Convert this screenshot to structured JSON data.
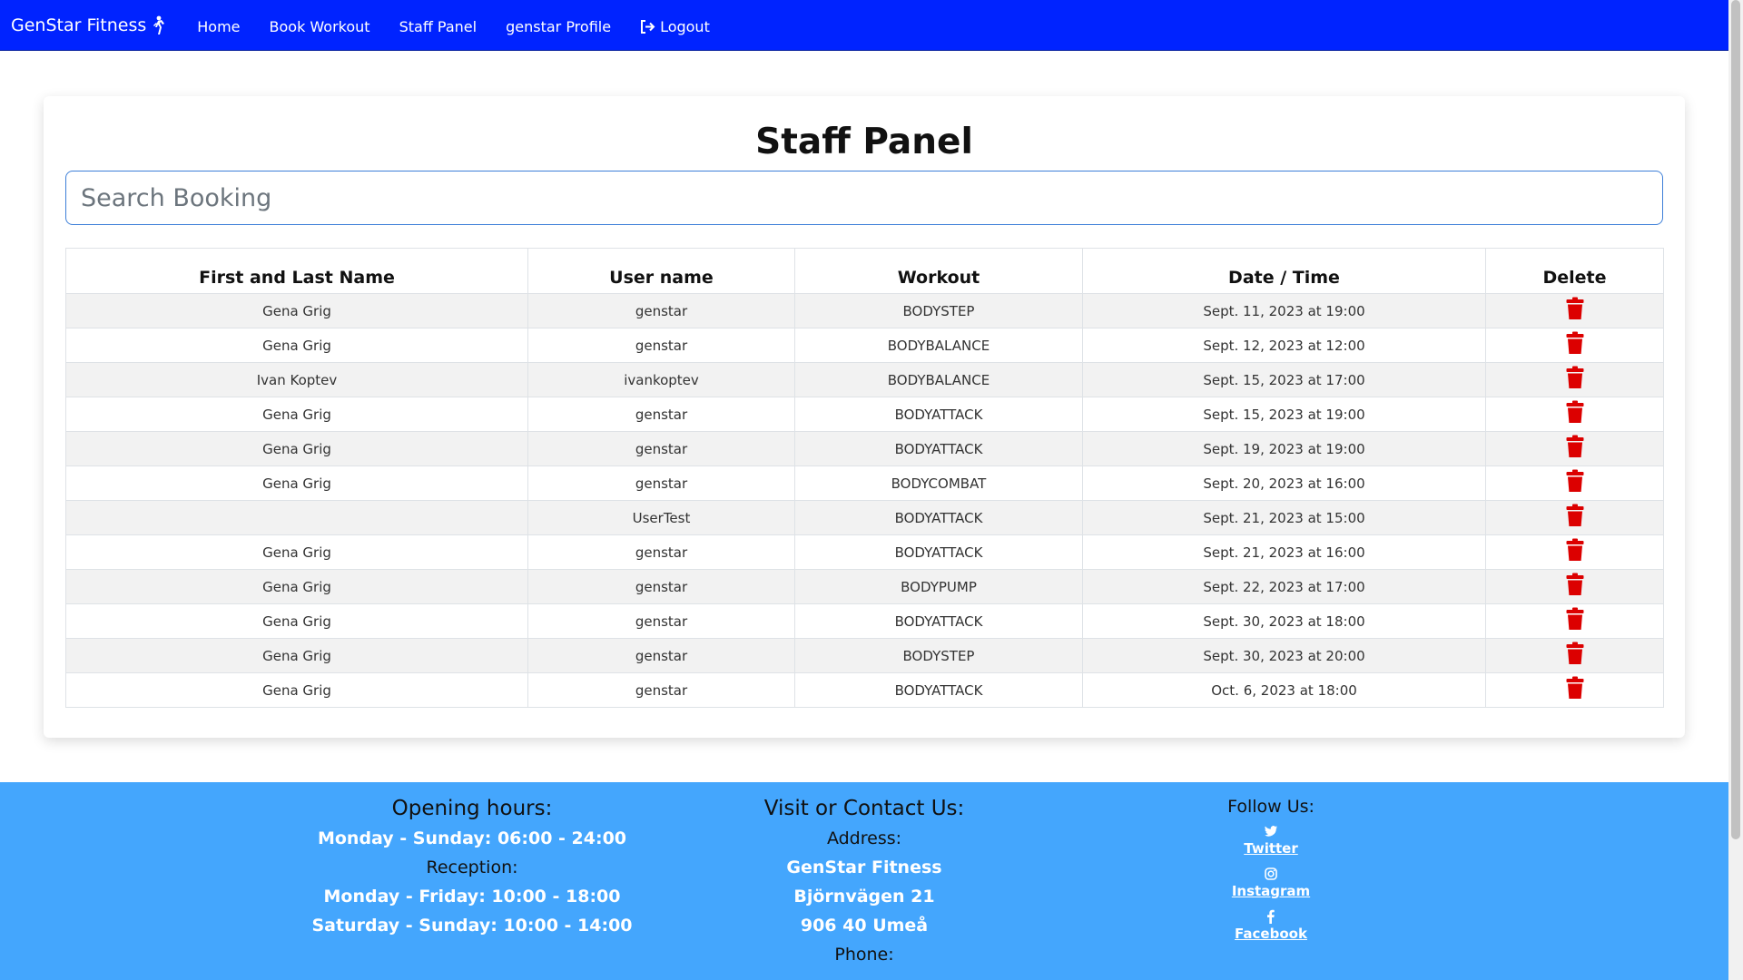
{
  "navbar": {
    "brand": "GenStar Fitness",
    "links": [
      {
        "label": "Home"
      },
      {
        "label": "Book Workout"
      },
      {
        "label": "Staff Panel"
      },
      {
        "label": "genstar Profile"
      },
      {
        "label": "Logout"
      }
    ],
    "color": "#0023ff"
  },
  "panel": {
    "title": "Staff Panel",
    "search_placeholder": "Search Booking"
  },
  "table": {
    "headers": [
      "First and Last Name",
      "User name",
      "Workout",
      "Date / Time",
      "Delete"
    ],
    "rows": [
      [
        "Gena Grig",
        "genstar",
        "BODYSTEP",
        "Sept. 11, 2023 at 19:00"
      ],
      [
        "Gena Grig",
        "genstar",
        "BODYBALANCE",
        "Sept. 12, 2023 at 12:00"
      ],
      [
        "Ivan Koptev",
        "ivankoptev",
        "BODYBALANCE",
        "Sept. 15, 2023 at 17:00"
      ],
      [
        "Gena Grig",
        "genstar",
        "BODYATTACK",
        "Sept. 15, 2023 at 19:00"
      ],
      [
        "Gena Grig",
        "genstar",
        "BODYATTACK",
        "Sept. 19, 2023 at 19:00"
      ],
      [
        "Gena Grig",
        "genstar",
        "BODYCOMBAT",
        "Sept. 20, 2023 at 16:00"
      ],
      [
        "",
        "UserTest",
        "BODYATTACK",
        "Sept. 21, 2023 at 15:00"
      ],
      [
        "Gena Grig",
        "genstar",
        "BODYATTACK",
        "Sept. 21, 2023 at 16:00"
      ],
      [
        "Gena Grig",
        "genstar",
        "BODYPUMP",
        "Sept. 22, 2023 at 17:00"
      ],
      [
        "Gena Grig",
        "genstar",
        "BODYATTACK",
        "Sept. 30, 2023 at 18:00"
      ],
      [
        "Gena Grig",
        "genstar",
        "BODYSTEP",
        "Sept. 30, 2023 at 20:00"
      ],
      [
        "Gena Grig",
        "genstar",
        "BODYATTACK",
        "Oct. 6, 2023 at 18:00"
      ]
    ],
    "delete_icon": "trash-icon",
    "delete_color": "#dc0000"
  },
  "footer": {
    "color": "#44a6fd",
    "opening": {
      "title": "Opening hours:",
      "hours": "Monday - Sunday: 06:00 - 24:00",
      "reception_label": "Reception:",
      "weekday": "Monday - Friday: 10:00 - 18:00",
      "weekend": "Saturday - Sunday: 10:00 - 14:00"
    },
    "contact": {
      "title": "Visit or Contact Us:",
      "address_label": "Address:",
      "name": "GenStar Fitness",
      "street": "Björnvägen 21",
      "city": "906 40 Umeå",
      "phone_label": "Phone:"
    },
    "social": {
      "title": "Follow Us:",
      "links": [
        {
          "label": "Twitter",
          "icon": "twitter-icon"
        },
        {
          "label": "Instagram",
          "icon": "instagram-icon"
        },
        {
          "label": "Facebook",
          "icon": "facebook-icon"
        }
      ]
    }
  }
}
